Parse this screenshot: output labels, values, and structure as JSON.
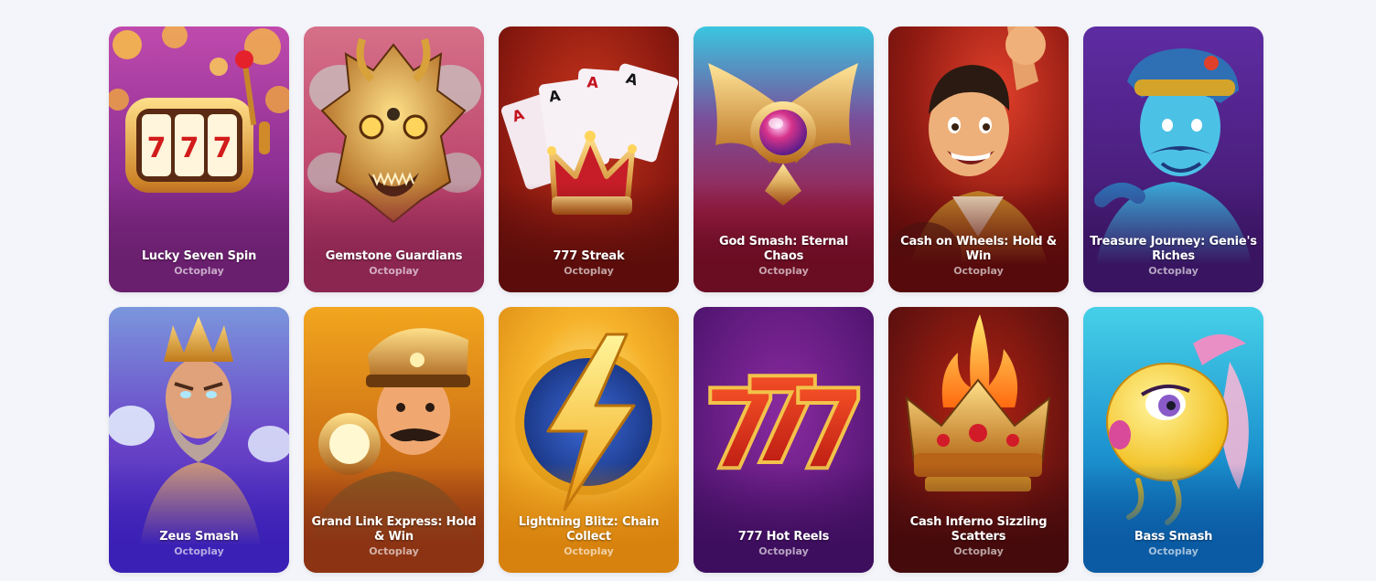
{
  "games": [
    {
      "title": "Lucky Seven Spin",
      "provider": "Octoplay",
      "icon": "slot-machine-icon",
      "colors": [
        "#c24fa9",
        "#8a2e8e",
        "#6b1f6f"
      ]
    },
    {
      "title": "Gemstone Guardians",
      "provider": "Octoplay",
      "icon": "dragon-mask-icon",
      "colors": [
        "#d56b84",
        "#b9416a",
        "#8a2450"
      ]
    },
    {
      "title": "777 Streak",
      "provider": "Octoplay",
      "icon": "cards-crown-icon",
      "colors": [
        "#b92d18",
        "#8c1a10",
        "#5e0d0b"
      ]
    },
    {
      "title": "God Smash: Eternal Chaos",
      "provider": "Octoplay",
      "icon": "winged-gem-icon",
      "colors": [
        "#2fb8d2",
        "#8f2c5e",
        "#6d0e22"
      ]
    },
    {
      "title": "Cash on Wheels: Hold & Win",
      "provider": "Octoplay",
      "icon": "driver-character-icon",
      "colors": [
        "#c52e1c",
        "#8f1a12",
        "#5a0b0c"
      ]
    },
    {
      "title": "Treasure Journey: Genie's Riches",
      "provider": "Octoplay",
      "icon": "genie-icon",
      "colors": [
        "#5b2a9e",
        "#4a1e7c",
        "#3a1561"
      ]
    },
    {
      "title": "Zeus Smash",
      "provider": "Octoplay",
      "icon": "zeus-icon",
      "colors": [
        "#6d8ad8",
        "#5a3bc4",
        "#3e23b4"
      ]
    },
    {
      "title": "Grand Link Express: Hold & Win",
      "provider": "Octoplay",
      "icon": "train-conductor-icon",
      "colors": [
        "#f0a21c",
        "#c96a14",
        "#8e3414"
      ]
    },
    {
      "title": "Lightning Blitz: Chain Collect",
      "provider": "Octoplay",
      "icon": "lightning-bolt-icon",
      "colors": [
        "#ffd54a",
        "#f4a51c",
        "#d8860e"
      ]
    },
    {
      "title": "777 Hot Reels",
      "provider": "Octoplay",
      "icon": "hot-sevens-icon",
      "colors": [
        "#7a2a95",
        "#5e1a7c",
        "#3f0e5f"
      ]
    },
    {
      "title": "Cash Inferno Sizzling Scatters",
      "provider": "Octoplay",
      "icon": "flaming-crown-icon",
      "colors": [
        "#9a1e12",
        "#6e1410",
        "#470a0c"
      ]
    },
    {
      "title": "Bass Smash",
      "provider": "Octoplay",
      "icon": "fish-icon",
      "colors": [
        "#38c7e3",
        "#1a8fcd",
        "#0c5fa6"
      ]
    }
  ]
}
